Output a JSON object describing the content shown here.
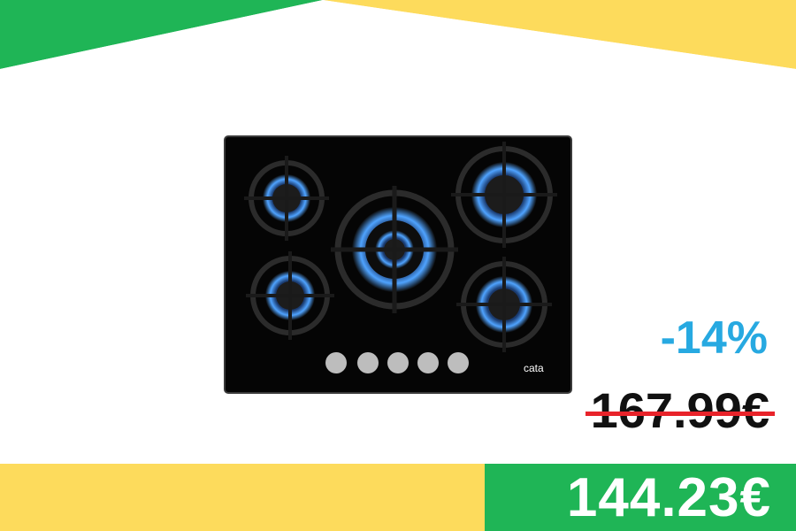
{
  "product": {
    "image_icon": "gas-hob-icon",
    "brand": "cata"
  },
  "pricing": {
    "discount": "-14%",
    "old_price": "167.99€",
    "current_price": "144.23€"
  },
  "colors": {
    "green": "#1fb556",
    "yellow": "#fddb5c",
    "discount_blue": "#27a9e1",
    "strike_red": "#e8232a"
  }
}
